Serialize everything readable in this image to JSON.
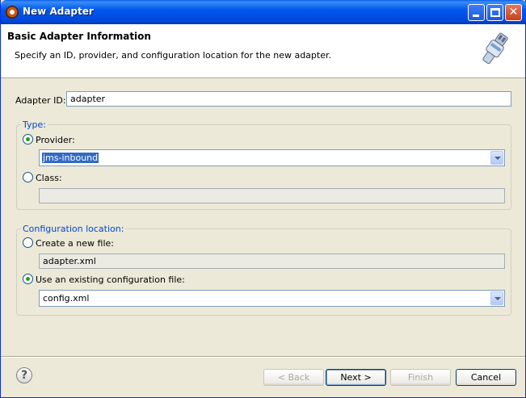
{
  "window": {
    "title": "New Adapter"
  },
  "banner": {
    "title": "Basic Adapter Information",
    "description": "Specify an ID, provider, and configuration location for the new adapter."
  },
  "adapter_id": {
    "label": "Adapter ID:",
    "value": "adapter"
  },
  "type_group": {
    "label": "Type:",
    "provider": {
      "label": "Provider:",
      "checked": true,
      "value": "jms-inbound"
    },
    "class": {
      "label": "Class:",
      "checked": false,
      "value": ""
    }
  },
  "config_group": {
    "label": "Configuration location:",
    "new_file": {
      "label": "Create a new file:",
      "checked": false,
      "value": "adapter.xml"
    },
    "existing_file": {
      "label": "Use an existing configuration file:",
      "checked": true,
      "value": "config.xml"
    }
  },
  "buttons": {
    "back": "< Back",
    "next": "Next >",
    "finish": "Finish",
    "cancel": "Cancel"
  },
  "icons": {
    "help": "help-icon",
    "app": "eclipse-icon",
    "banner": "adapter-plug-icon"
  }
}
